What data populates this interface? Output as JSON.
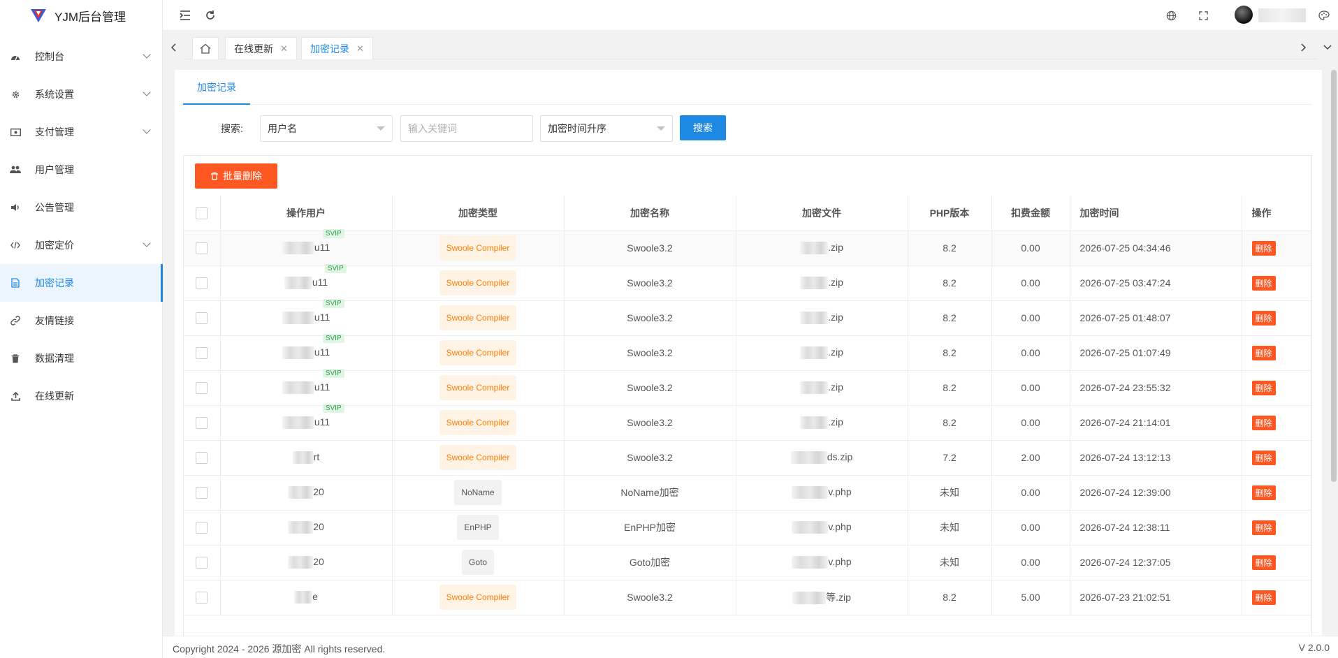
{
  "app": {
    "title": "YJM后台管理"
  },
  "sidebar": {
    "items": [
      {
        "label": "控制台",
        "icon": "dashboard-icon",
        "expandable": true
      },
      {
        "label": "系统设置",
        "icon": "gear-icon",
        "expandable": true
      },
      {
        "label": "支付管理",
        "icon": "payment-icon",
        "expandable": true
      },
      {
        "label": "用户管理",
        "icon": "users-icon",
        "expandable": false
      },
      {
        "label": "公告管理",
        "icon": "speaker-icon",
        "expandable": false
      },
      {
        "label": "加密定价",
        "icon": "code-icon",
        "expandable": true
      },
      {
        "label": "加密记录",
        "icon": "document-icon",
        "expandable": false,
        "active": true
      },
      {
        "label": "友情链接",
        "icon": "link-icon",
        "expandable": false
      },
      {
        "label": "数据清理",
        "icon": "trash-icon",
        "expandable": false
      },
      {
        "label": "在线更新",
        "icon": "upload-icon",
        "expandable": false
      }
    ]
  },
  "tabs": {
    "items": [
      {
        "label": "在线更新",
        "active": false
      },
      {
        "label": "加密记录",
        "active": true
      }
    ],
    "close_symbol": "✕"
  },
  "page": {
    "subtab": "加密记录",
    "search": {
      "label": "搜索:",
      "field_select": "用户名",
      "keyword_placeholder": "输入关键词",
      "sort_select": "加密时间升序",
      "button": "搜索"
    },
    "batch_delete": "批量删除"
  },
  "table": {
    "columns": [
      "操作用户",
      "加密类型",
      "加密名称",
      "加密文件",
      "PHP版本",
      "扣费金额",
      "加密时间",
      "操作"
    ],
    "rows": [
      {
        "user": "u11",
        "svip": "SVIP",
        "type": "Swoole Compiler",
        "name": "Swoole3.2",
        "file": ".zip",
        "php": "8.2",
        "amount": "0.00",
        "time": "2026-07-25 04:34:46",
        "action": "删除"
      },
      {
        "user": "u11",
        "svip": "SVIP",
        "type": "Swoole Compiler",
        "name": "Swoole3.2",
        "file": ".zip",
        "php": "8.2",
        "amount": "0.00",
        "time": "2026-07-25 03:47:24",
        "action": "删除"
      },
      {
        "user": "u11",
        "svip": "SVIP",
        "type": "Swoole Compiler",
        "name": "Swoole3.2",
        "file": ".zip",
        "php": "8.2",
        "amount": "0.00",
        "time": "2026-07-25 01:48:07",
        "action": "删除"
      },
      {
        "user": "u11",
        "svip": "SVIP",
        "type": "Swoole Compiler",
        "name": "Swoole3.2",
        "file": ".zip",
        "php": "8.2",
        "amount": "0.00",
        "time": "2026-07-25 01:07:49",
        "action": "删除"
      },
      {
        "user": "u11",
        "svip": "SVIP",
        "type": "Swoole Compiler",
        "name": "Swoole3.2",
        "file": ".zip",
        "php": "8.2",
        "amount": "0.00",
        "time": "2026-07-24 23:55:32",
        "action": "删除"
      },
      {
        "user": "u11",
        "svip": "SVIP",
        "type": "Swoole Compiler",
        "name": "Swoole3.2",
        "file": ".zip",
        "php": "8.2",
        "amount": "0.00",
        "time": "2026-07-24 21:14:01",
        "action": "删除"
      },
      {
        "user": "rt",
        "svip": "",
        "type": "Swoole Compiler",
        "name": "Swoole3.2",
        "file": "ds.zip",
        "php": "7.2",
        "amount": "2.00",
        "time": "2026-07-24 13:12:13",
        "action": "删除"
      },
      {
        "user": "20",
        "svip": "",
        "type": "NoName",
        "name": "NoName加密",
        "file": "v.php",
        "php": "未知",
        "amount": "0.00",
        "time": "2026-07-24 12:39:00",
        "action": "删除"
      },
      {
        "user": "20",
        "svip": "",
        "type": "EnPHP",
        "name": "EnPHP加密",
        "file": "v.php",
        "php": "未知",
        "amount": "0.00",
        "time": "2026-07-24 12:38:11",
        "action": "删除"
      },
      {
        "user": "20",
        "svip": "",
        "type": "Goto",
        "name": "Goto加密",
        "file": "v.php",
        "php": "未知",
        "amount": "0.00",
        "time": "2026-07-24 12:37:05",
        "action": "删除"
      },
      {
        "user": "e",
        "svip": "",
        "type": "Swoole Compiler",
        "name": "Swoole3.2",
        "file": "等.zip",
        "php": "8.2",
        "amount": "5.00",
        "time": "2026-07-23 21:02:51",
        "action": "删除"
      }
    ]
  },
  "footer": {
    "copyright": "Copyright 2024 - 2026 源加密 All rights reserved.",
    "version": "V 2.0.0"
  },
  "colors": {
    "primary": "#1e88e5",
    "danger": "#ff5722",
    "swoole_tag_bg": "#fff3e5",
    "swoole_tag_text": "#ff7d00",
    "svip_bg": "#dff5e3",
    "svip_text": "#2e9a48"
  }
}
